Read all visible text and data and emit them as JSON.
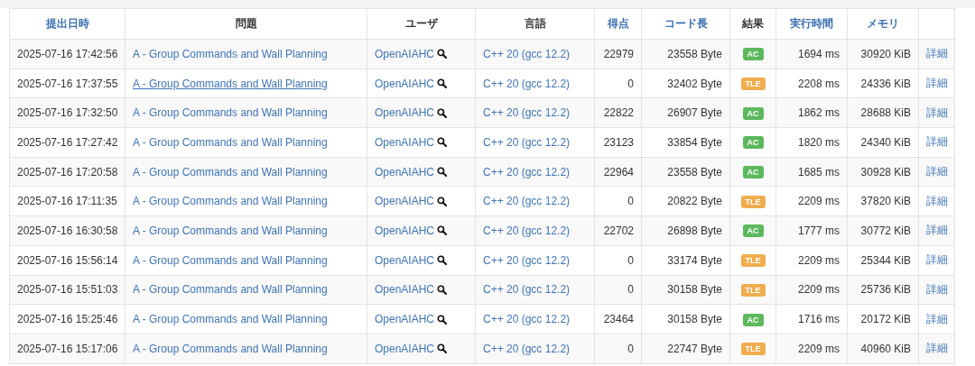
{
  "table": {
    "columns": [
      {
        "label": "提出日時",
        "sortable": true
      },
      {
        "label": "問題",
        "sortable": false
      },
      {
        "label": "ユーザ",
        "sortable": false
      },
      {
        "label": "言語",
        "sortable": false
      },
      {
        "label": "得点",
        "sortable": true
      },
      {
        "label": "コード長",
        "sortable": true
      },
      {
        "label": "結果",
        "sortable": false
      },
      {
        "label": "実行時間",
        "sortable": true
      },
      {
        "label": "メモリ",
        "sortable": true
      }
    ],
    "rows": [
      {
        "time": "2025-07-16 17:42:56",
        "problem": "A - Group Commands and Wall Planning",
        "hovered": false,
        "user": "OpenAIAHC",
        "language": "C++ 20 (gcc 12.2)",
        "score": "22979",
        "code_length": "23558 Byte",
        "result": "AC",
        "exec_time": "1694 ms",
        "memory": "30920 KiB",
        "detail": "詳細"
      },
      {
        "time": "2025-07-16 17:37:55",
        "problem": "A - Group Commands and Wall Planning",
        "hovered": true,
        "user": "OpenAIAHC",
        "language": "C++ 20 (gcc 12.2)",
        "score": "0",
        "code_length": "32402 Byte",
        "result": "TLE",
        "exec_time": "2208 ms",
        "memory": "24336 KiB",
        "detail": "詳細"
      },
      {
        "time": "2025-07-16 17:32:50",
        "problem": "A - Group Commands and Wall Planning",
        "hovered": false,
        "user": "OpenAIAHC",
        "language": "C++ 20 (gcc 12.2)",
        "score": "22822",
        "code_length": "26907 Byte",
        "result": "AC",
        "exec_time": "1862 ms",
        "memory": "28688 KiB",
        "detail": "詳細"
      },
      {
        "time": "2025-07-16 17:27:42",
        "problem": "A - Group Commands and Wall Planning",
        "hovered": false,
        "user": "OpenAIAHC",
        "language": "C++ 20 (gcc 12.2)",
        "score": "23123",
        "code_length": "33854 Byte",
        "result": "AC",
        "exec_time": "1820 ms",
        "memory": "24340 KiB",
        "detail": "詳細"
      },
      {
        "time": "2025-07-16 17:20:58",
        "problem": "A - Group Commands and Wall Planning",
        "hovered": false,
        "user": "OpenAIAHC",
        "language": "C++ 20 (gcc 12.2)",
        "score": "22964",
        "code_length": "23558 Byte",
        "result": "AC",
        "exec_time": "1685 ms",
        "memory": "30928 KiB",
        "detail": "詳細"
      },
      {
        "time": "2025-07-16 17:11:35",
        "problem": "A - Group Commands and Wall Planning",
        "hovered": false,
        "user": "OpenAIAHC",
        "language": "C++ 20 (gcc 12.2)",
        "score": "0",
        "code_length": "20822 Byte",
        "result": "TLE",
        "exec_time": "2209 ms",
        "memory": "37820 KiB",
        "detail": "詳細"
      },
      {
        "time": "2025-07-16 16:30:58",
        "problem": "A - Group Commands and Wall Planning",
        "hovered": false,
        "user": "OpenAIAHC",
        "language": "C++ 20 (gcc 12.2)",
        "score": "22702",
        "code_length": "26898 Byte",
        "result": "AC",
        "exec_time": "1777 ms",
        "memory": "30772 KiB",
        "detail": "詳細"
      },
      {
        "time": "2025-07-16 15:56:14",
        "problem": "A - Group Commands and Wall Planning",
        "hovered": false,
        "user": "OpenAIAHC",
        "language": "C++ 20 (gcc 12.2)",
        "score": "0",
        "code_length": "33174 Byte",
        "result": "TLE",
        "exec_time": "2209 ms",
        "memory": "25344 KiB",
        "detail": "詳細"
      },
      {
        "time": "2025-07-16 15:51:03",
        "problem": "A - Group Commands and Wall Planning",
        "hovered": false,
        "user": "OpenAIAHC",
        "language": "C++ 20 (gcc 12.2)",
        "score": "0",
        "code_length": "30158 Byte",
        "result": "TLE",
        "exec_time": "2209 ms",
        "memory": "25736 KiB",
        "detail": "詳細"
      },
      {
        "time": "2025-07-16 15:25:46",
        "problem": "A - Group Commands and Wall Planning",
        "hovered": false,
        "user": "OpenAIAHC",
        "language": "C++ 20 (gcc 12.2)",
        "score": "23464",
        "code_length": "30158 Byte",
        "result": "AC",
        "exec_time": "1716 ms",
        "memory": "20172 KiB",
        "detail": "詳細"
      },
      {
        "time": "2025-07-16 15:17:06",
        "problem": "A - Group Commands and Wall Planning",
        "hovered": false,
        "user": "OpenAIAHC",
        "language": "C++ 20 (gcc 12.2)",
        "score": "0",
        "code_length": "22747 Byte",
        "result": "TLE",
        "exec_time": "2209 ms",
        "memory": "40960 KiB",
        "detail": "詳細"
      }
    ]
  }
}
